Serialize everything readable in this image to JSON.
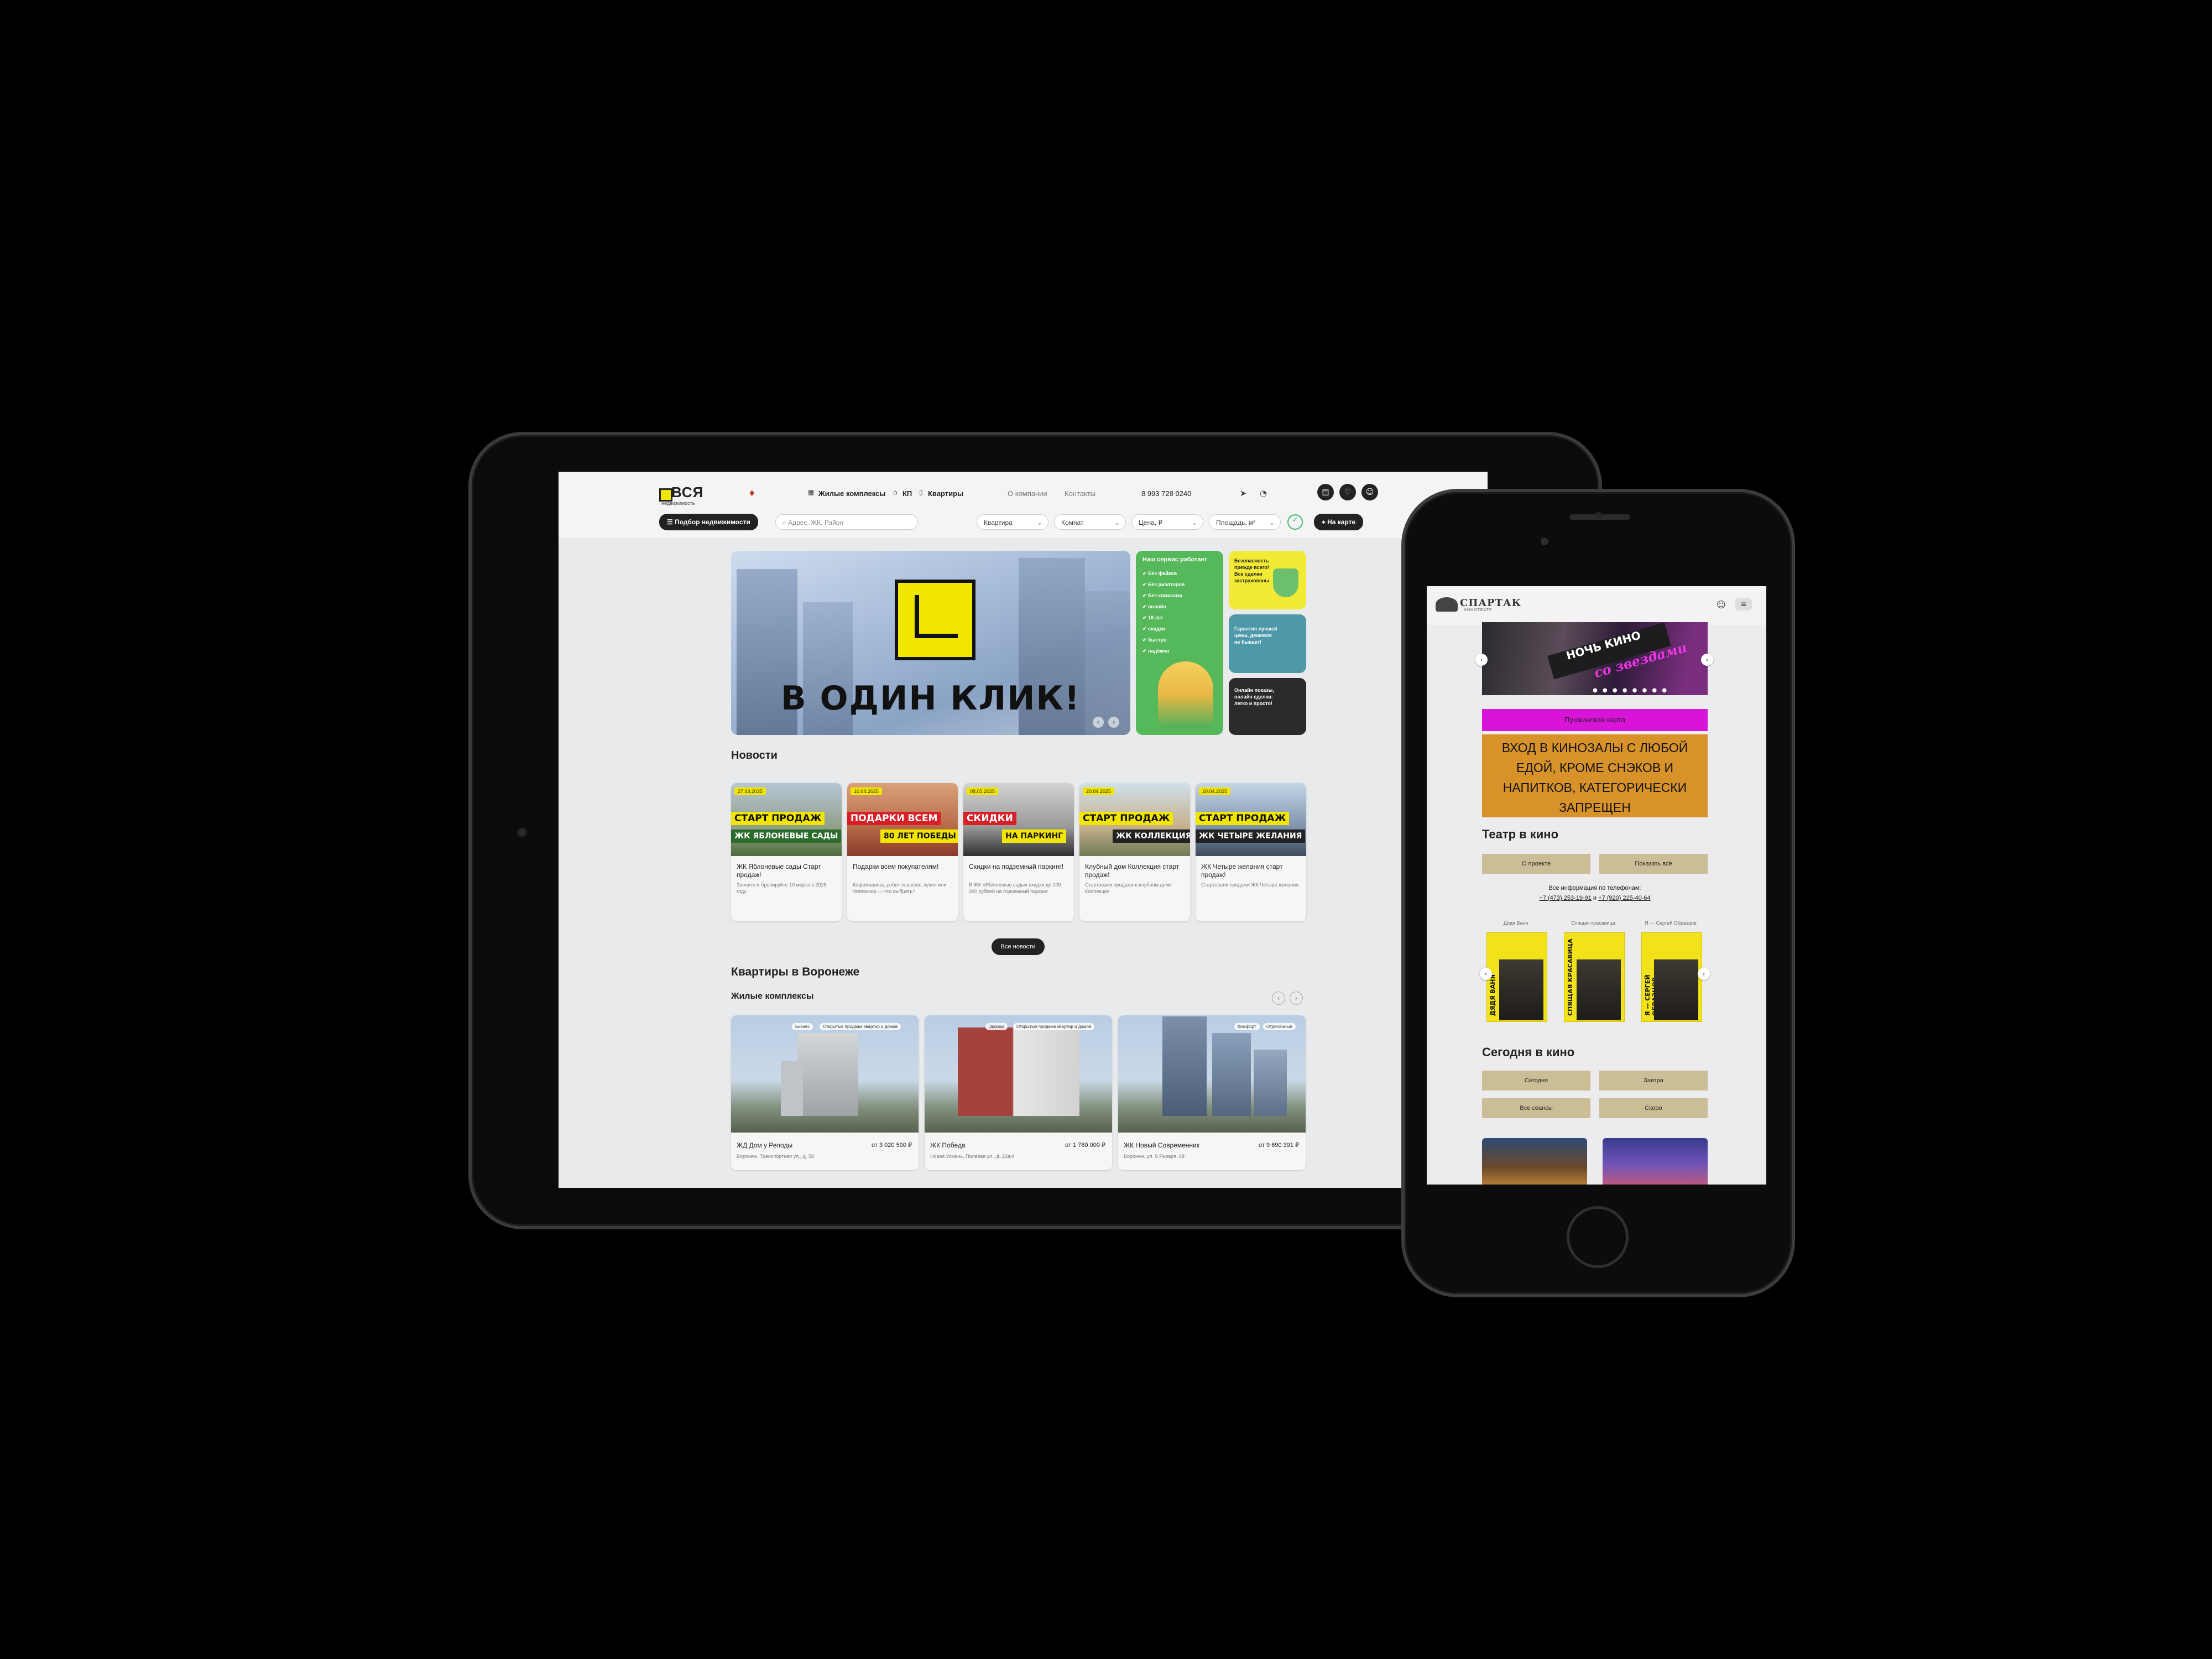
{
  "tablet": {
    "logo": {
      "name": "ВСЯ",
      "tagline": "недвижимость"
    },
    "nav": [
      "Жилые комплексы",
      "КП",
      "Квартиры"
    ],
    "nav_secondary": [
      "О компании",
      "Контакты"
    ],
    "phone": "8 993 728 0240",
    "filters": {
      "pick_button": "Подбор недвижимости",
      "search_placeholder": "Адрес, ЖК, Район",
      "type": "Квартира",
      "rooms": "Комнат",
      "price": "Цена, ₽",
      "area": "Площадь, м²",
      "map_button": "На карте"
    },
    "hero": {
      "title": "В ОДИН КЛИК!"
    },
    "promo_green": {
      "title": "Наш сервис работает",
      "items": [
        "Без фейков",
        "Без риэлторов",
        "Без комиссии",
        "онлайн",
        "18 лет",
        "скидки",
        "быстро",
        "надёжно"
      ]
    },
    "promo_yellow": "Безопасность прежде всего! Все сделки застрахованы",
    "promo_teal": "Гарантия лучшей цены, дешевле не бывает!",
    "promo_dark": "Онлайн показы, онлайн сделки: легко и просто!",
    "news_title": "Новости",
    "news": [
      {
        "date": "27.03.2025",
        "band1": "СТАРТ ПРОДАЖ",
        "band2": "ЖК ЯБЛОНЕВЫЕ САДЫ",
        "title": "ЖК Яблоневые сады Старт продаж!",
        "desc": "Звоните и бронируйте 10 марта в 2025 году"
      },
      {
        "date": "10.04.2025",
        "band1": "ПОДАРКИ ВСЕМ",
        "band2": "80 ЛЕТ ПОБЕДЫ",
        "title": "Подарки всем покупателям!",
        "desc": "Кофемашина, робот-пылесос, кухня или телевизор — что выбрать?"
      },
      {
        "date": "08.05.2025",
        "band1": "СКИДКИ",
        "band2": "НА ПАРКИНГ",
        "title": "Скидки на подземный паркинг!",
        "desc": "В ЖК «Яблоневые сады» скидки до 200 000 рублей на подземный паркинг"
      },
      {
        "date": "20.04.2025",
        "band1": "СТАРТ ПРОДАЖ",
        "band2": "ЖК КОЛЛЕКЦИЯ",
        "title": "Клубный дом Коллекция старт продаж!",
        "desc": "Стартовали продажи в клубном доме Коллекция"
      },
      {
        "date": "20.04.2025",
        "band1": "СТАРТ ПРОДАЖ",
        "band2": "ЖК ЧЕТЫРЕ ЖЕЛАНИЯ",
        "title": "ЖК Четыре желания старт продаж!",
        "desc": "Стартовали продажи ЖК Четыре желания"
      }
    ],
    "all_news": "Все новости",
    "apartments_title": "Квартиры в Воронеже",
    "complexes_title": "Жилые комплексы",
    "complexes": [
      {
        "name": "ЖД Дом у Реподы",
        "price": "от 3 020 500 ₽",
        "address": "Воронеж, Транспортная ул., д. 58",
        "tags": [
          "Бизнес",
          "Открытые продажи квартир и домов"
        ]
      },
      {
        "name": "ЖК Победа",
        "price": "от 1 780 000 ₽",
        "address": "Новая Усмань, Полевая ул., д. 22а/4",
        "tags": [
          "Эконом",
          "Открытые продажи квартир и домов"
        ]
      },
      {
        "name": "ЖК Новый Современник",
        "price": "от 9 690 391 ₽",
        "address": "Воронеж, ул. 9 Января, 68",
        "tags": [
          "Комфорт",
          "Отделанные"
        ]
      }
    ]
  },
  "phone": {
    "logo": {
      "name": "СПАРТАК",
      "tagline": "КИНОТЕАТР"
    },
    "banner": {
      "line1": "НОЧЬ КИНО",
      "line2": "со звездами"
    },
    "pushkin": "Пушкинская карта",
    "notice": "ВХОД В КИНОЗАЛЫ С ЛЮБОЙ ЕДОЙ, КРОМЕ СНЭКОВ И НАПИТКОВ, КАТЕГОРИЧЕСКИ ЗАПРЕЩЕН",
    "theatre_title": "Театр в кино",
    "btn_about": "О проекте",
    "btn_show_all": "Показать всё",
    "info": "Все информация по телефонам:",
    "phone1": "+7 (473) 253-19-91",
    "or": "и",
    "phone2": "+7 (920) 225-40-64",
    "posters": [
      {
        "label": "Дядя Ваня",
        "title": "ДЯДЯ ВАНЯ"
      },
      {
        "label": "Спящая красавица",
        "title": "СПЯЩАЯ КРАСАВИЦА"
      },
      {
        "label": "Я — Сергей Образцов",
        "title": "Я — СЕРГЕЙ ОБРАЗЦОВ"
      }
    ],
    "today_title": "Сегодня в кино",
    "tabs": [
      "Сегодня",
      "Завтра",
      "Все сеансы",
      "Скоро"
    ]
  },
  "colors": {
    "accent_yellow": "#f2e600",
    "magenta": "#d814d9",
    "orange": "#d8922a",
    "beige": "#cbbd95",
    "green": "#55b85a"
  }
}
